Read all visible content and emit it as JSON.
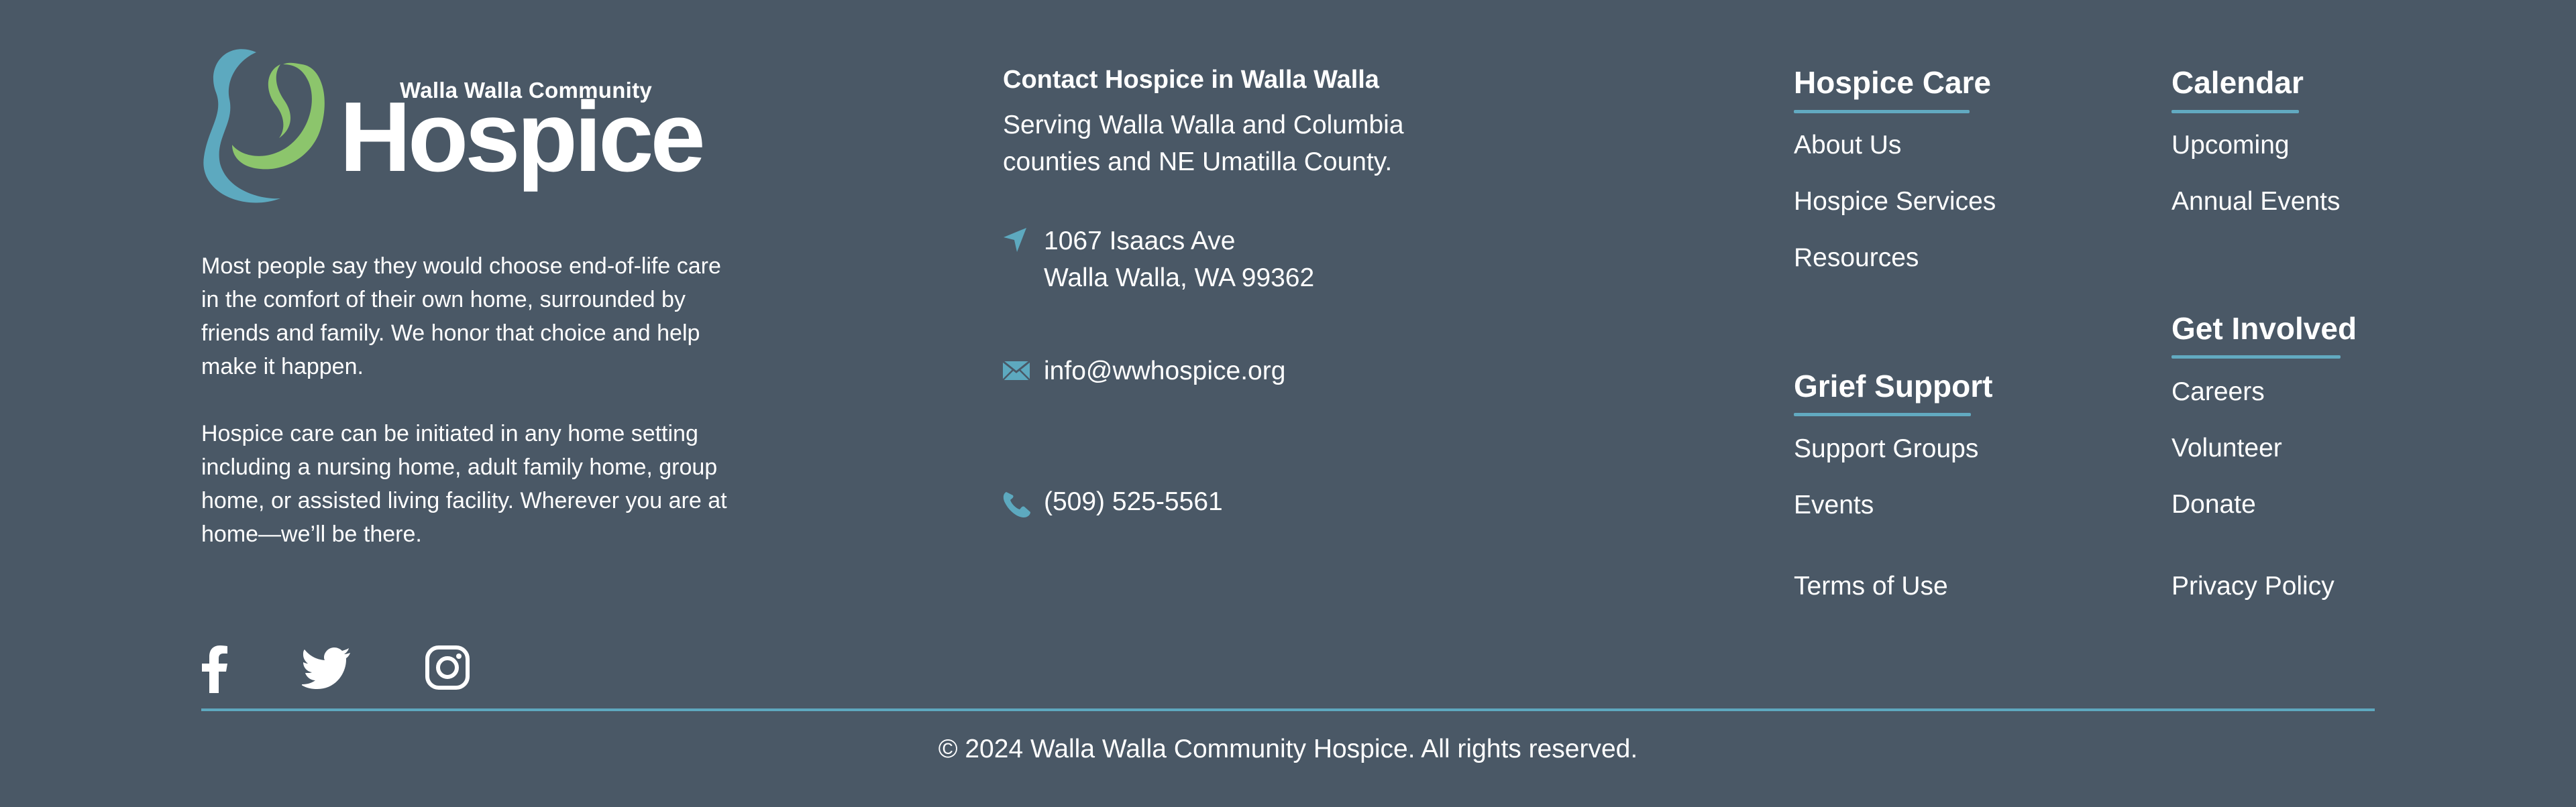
{
  "logo": {
    "subtitle": "Walla Walla Community",
    "wordmark": "Hospice",
    "colors": {
      "green": "#8cc56c",
      "blue": "#5da9bf"
    }
  },
  "about": {
    "paragraph1": "Most people say they would choose end-of-life care in the comfort of their own home, surrounded by friends and family. We honor that choice and help make it happen.",
    "paragraph2": "Hospice care can be initiated in any home setting including a nursing home, adult family home, group home, or assisted living facility. Wherever you are at home—we’ll be there."
  },
  "contact": {
    "title": "Contact Hospice in Walla Walla",
    "serving_line1": "Serving Walla Walla and Columbia",
    "serving_line2": "counties and NE Umatilla County.",
    "address_line1": "1067 Isaacs Ave",
    "address_line2": "Walla Walla, WA 99362",
    "email": "info@wwhospice.org",
    "phone": "(509) 525-5561",
    "icons": {
      "address": "location-arrow-icon",
      "email": "envelope-icon",
      "phone": "phone-icon"
    }
  },
  "nav": {
    "hospice_care": {
      "heading": "Hospice Care",
      "links": [
        "About Us",
        "Hospice Services",
        "Resources"
      ]
    },
    "grief_support": {
      "heading": "Grief Support",
      "links": [
        "Support Groups",
        "Events"
      ]
    },
    "calendar": {
      "heading": "Calendar",
      "links": [
        "Upcoming",
        "Annual Events"
      ]
    },
    "get_involved": {
      "heading": "Get Involved",
      "links": [
        "Careers",
        "Volunteer",
        "Donate"
      ]
    },
    "terms": "Terms of Use",
    "privacy": "Privacy Policy"
  },
  "social": [
    "facebook-icon",
    "twitter-icon",
    "instagram-icon"
  ],
  "footer": {
    "copyright": "© 2024 Walla Walla Community Hospice. All rights reserved."
  },
  "colors": {
    "background": "#4a5866",
    "accent": "#5da9bf",
    "text": "#ffffff"
  }
}
